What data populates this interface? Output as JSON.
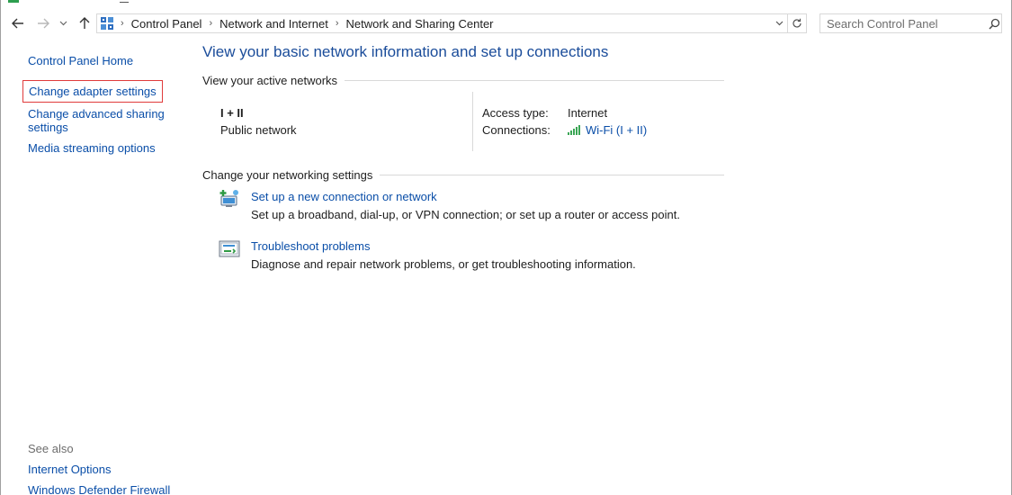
{
  "colors": {
    "link": "#0a4ea8",
    "title": "#1a4c9a",
    "highlight_border": "#e03b3b",
    "signal": "#3aa655"
  },
  "nav": {
    "back_icon": "arrow-left-icon",
    "forward_icon": "arrow-right-icon",
    "recent_icon": "chevron-down-icon",
    "up_icon": "arrow-up-icon"
  },
  "address": {
    "icon": "control-panel-icon",
    "crumbs": [
      "Control Panel",
      "Network and Internet",
      "Network and Sharing Center"
    ]
  },
  "search": {
    "placeholder": "Search Control Panel",
    "icon": "search-icon"
  },
  "sidebar": {
    "home": "Control Panel Home",
    "links": [
      "Change adapter settings",
      "Change advanced sharing settings",
      "Media streaming options"
    ],
    "see_also_title": "See also",
    "see_also": [
      "Internet Options",
      "Windows Defender Firewall"
    ]
  },
  "main": {
    "title": "View your basic network information and set up connections",
    "active_networks_heading": "View your active networks",
    "network": {
      "name": "I + II",
      "category": "Public network",
      "access_type_label": "Access type:",
      "access_type_value": "Internet",
      "connections_label": "Connections:",
      "connections_value": "Wi-Fi (I + II)"
    },
    "change_settings_heading": "Change your networking settings",
    "tasks": [
      {
        "icon": "new-connection-icon",
        "link": "Set up a new connection or network",
        "description": "Set up a broadband, dial-up, or VPN connection; or set up a router or access point."
      },
      {
        "icon": "troubleshoot-icon",
        "link": "Troubleshoot problems",
        "description": "Diagnose and repair network problems, or get troubleshooting information."
      }
    ]
  }
}
